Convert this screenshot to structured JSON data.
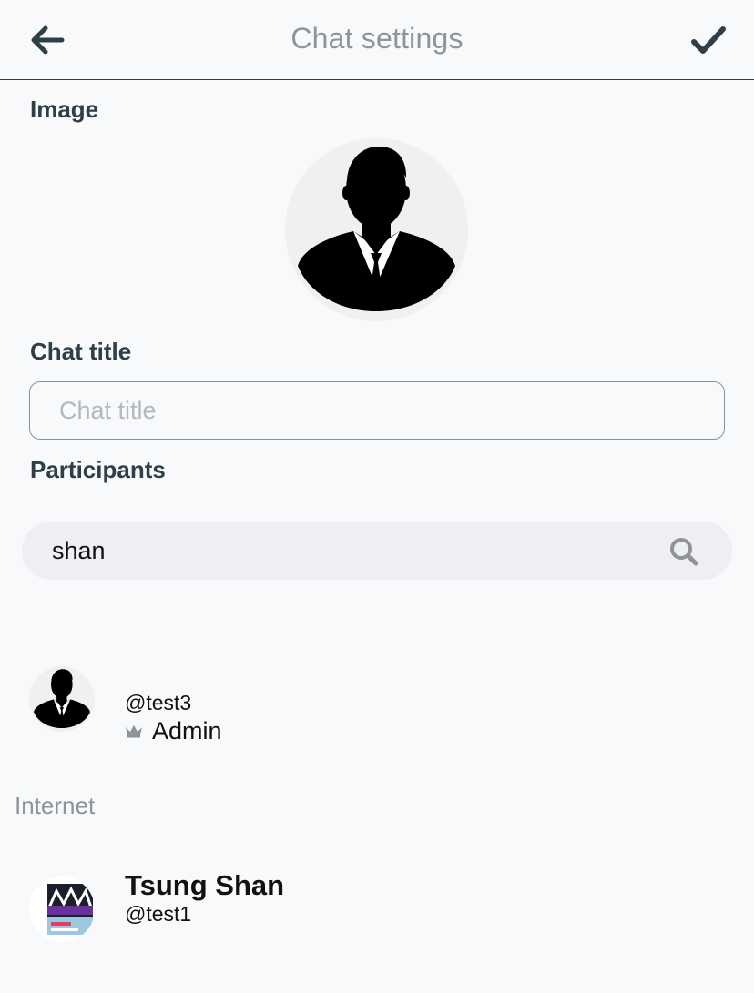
{
  "header": {
    "title": "Chat settings",
    "back_icon": "arrow-left-icon",
    "confirm_icon": "checkmark-icon",
    "icon_color": "#2f3f47"
  },
  "image_section": {
    "label": "Image",
    "avatar_icon": "person-silhouette-icon"
  },
  "chat_title": {
    "label": "Chat title",
    "placeholder": "Chat title",
    "value": ""
  },
  "participants": {
    "label": "Participants",
    "search_value": "shan",
    "search_icon": "search-icon",
    "members": [
      {
        "handle": "@test3",
        "role": "Admin",
        "role_icon": "crown-icon",
        "avatar_icon": "person-silhouette-icon"
      }
    ]
  },
  "internet": {
    "section_title": "Internet",
    "results": [
      {
        "name": "Tsung Shan",
        "handle": "@test1",
        "avatar": "photo-avatar"
      }
    ]
  },
  "colors": {
    "background": "#f8f9fb",
    "text_dark": "#2f3f47",
    "muted": "#8e9497",
    "search_bg": "#efeff3"
  }
}
